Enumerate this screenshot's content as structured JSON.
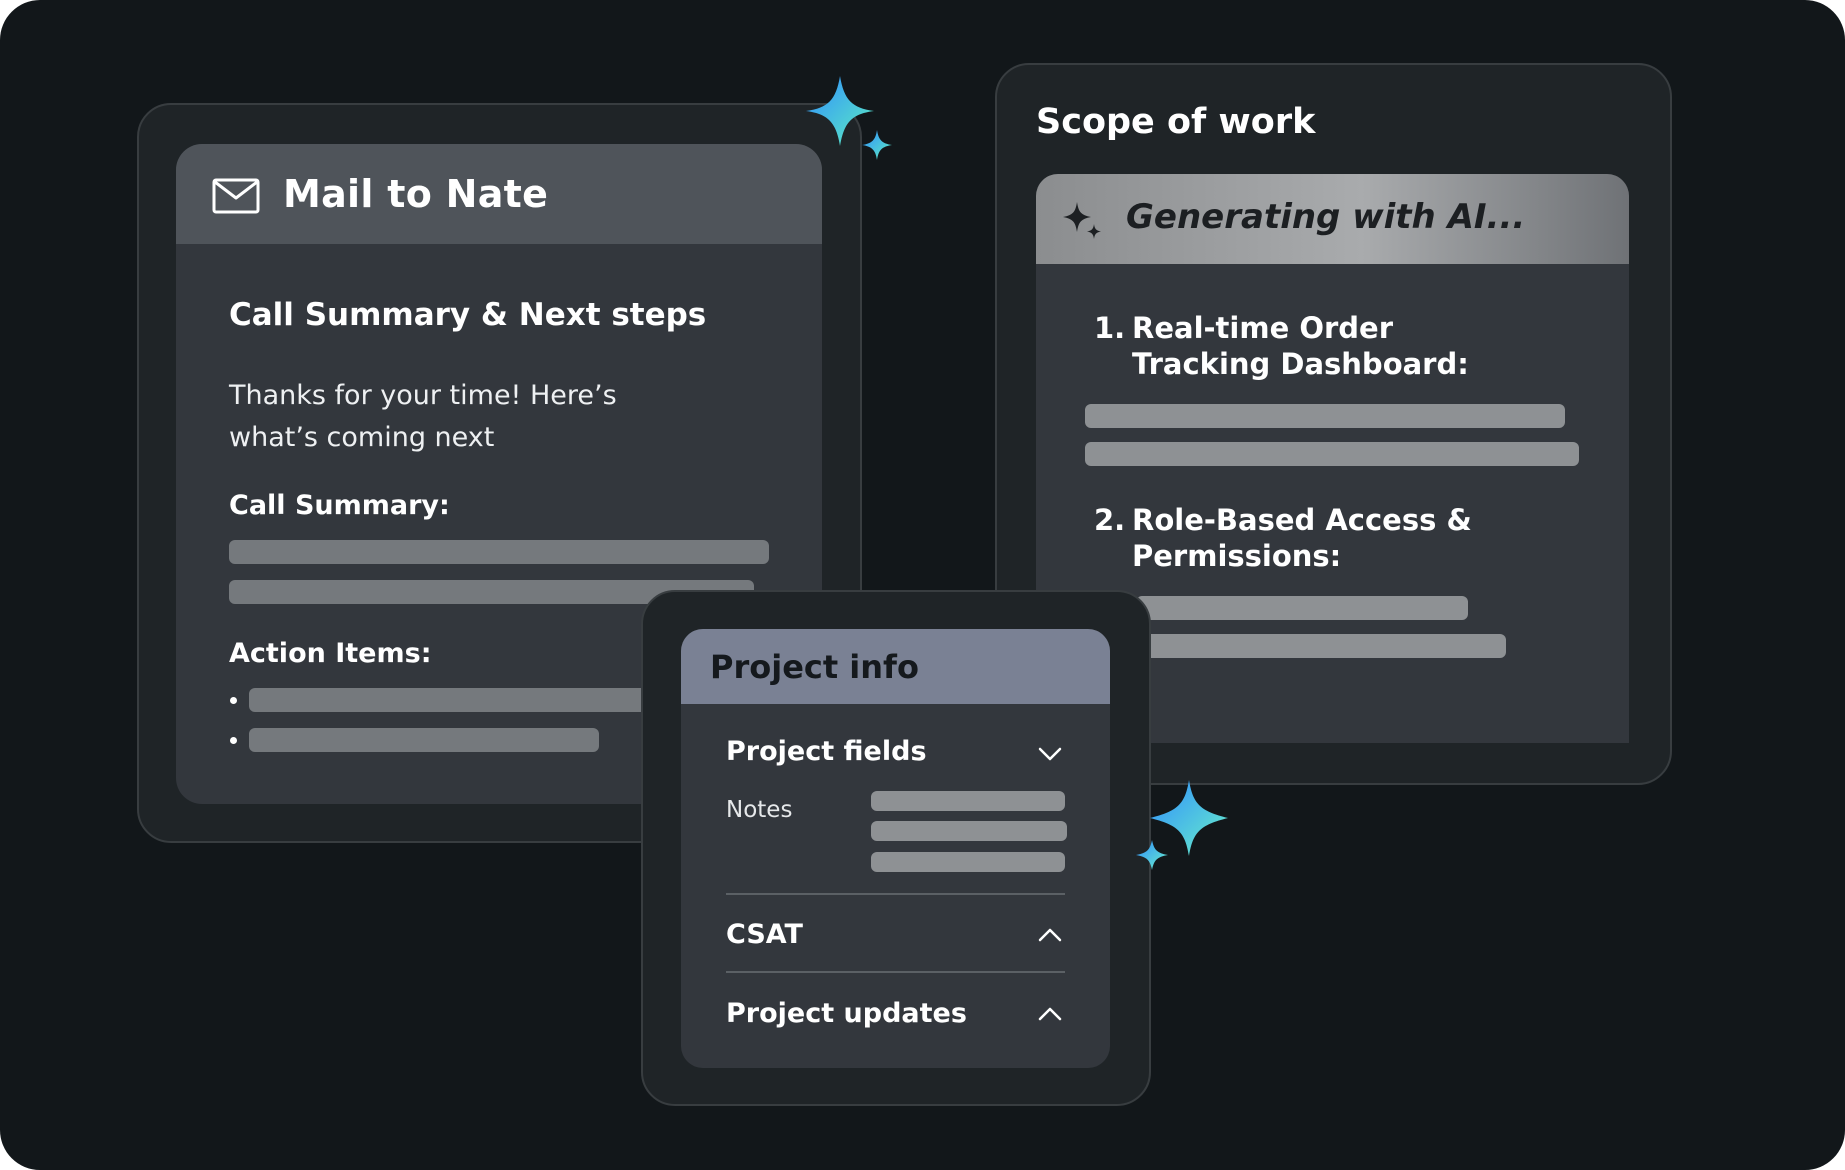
{
  "mail_card": {
    "title": "Mail to Nate",
    "icon": "mail-icon",
    "subject": "Call Summary & Next steps",
    "body": "Thanks for your time! Here’s what’s coming next",
    "call_summary_label": "Call Summary:",
    "action_items_label": "Action Items:"
  },
  "scope_card": {
    "title": "Scope of work",
    "status_icon": "sparkle-icon",
    "status": "Generating with AI...",
    "items": [
      {
        "number": "1.",
        "label": "Real-time Order Tracking Dashboard:"
      },
      {
        "number": "2.",
        "label": "Role-Based Access & Permissions:"
      }
    ]
  },
  "project_card": {
    "title": "Project info",
    "sections": [
      {
        "label": "Project fields",
        "state": "expanded",
        "chevron": "chevron-down-icon"
      },
      {
        "label": "CSAT",
        "state": "collapsed",
        "chevron": "chevron-up-icon"
      },
      {
        "label": "Project updates",
        "state": "collapsed",
        "chevron": "chevron-up-icon"
      }
    ],
    "notes_label": "Notes"
  },
  "colors": {
    "background": "#12171a",
    "card": "#33373d",
    "mail_header": "#4f545a",
    "project_header": "#7a8194",
    "sparkle_gradient": [
      "#3aa0ff",
      "#5ef0c0"
    ]
  }
}
